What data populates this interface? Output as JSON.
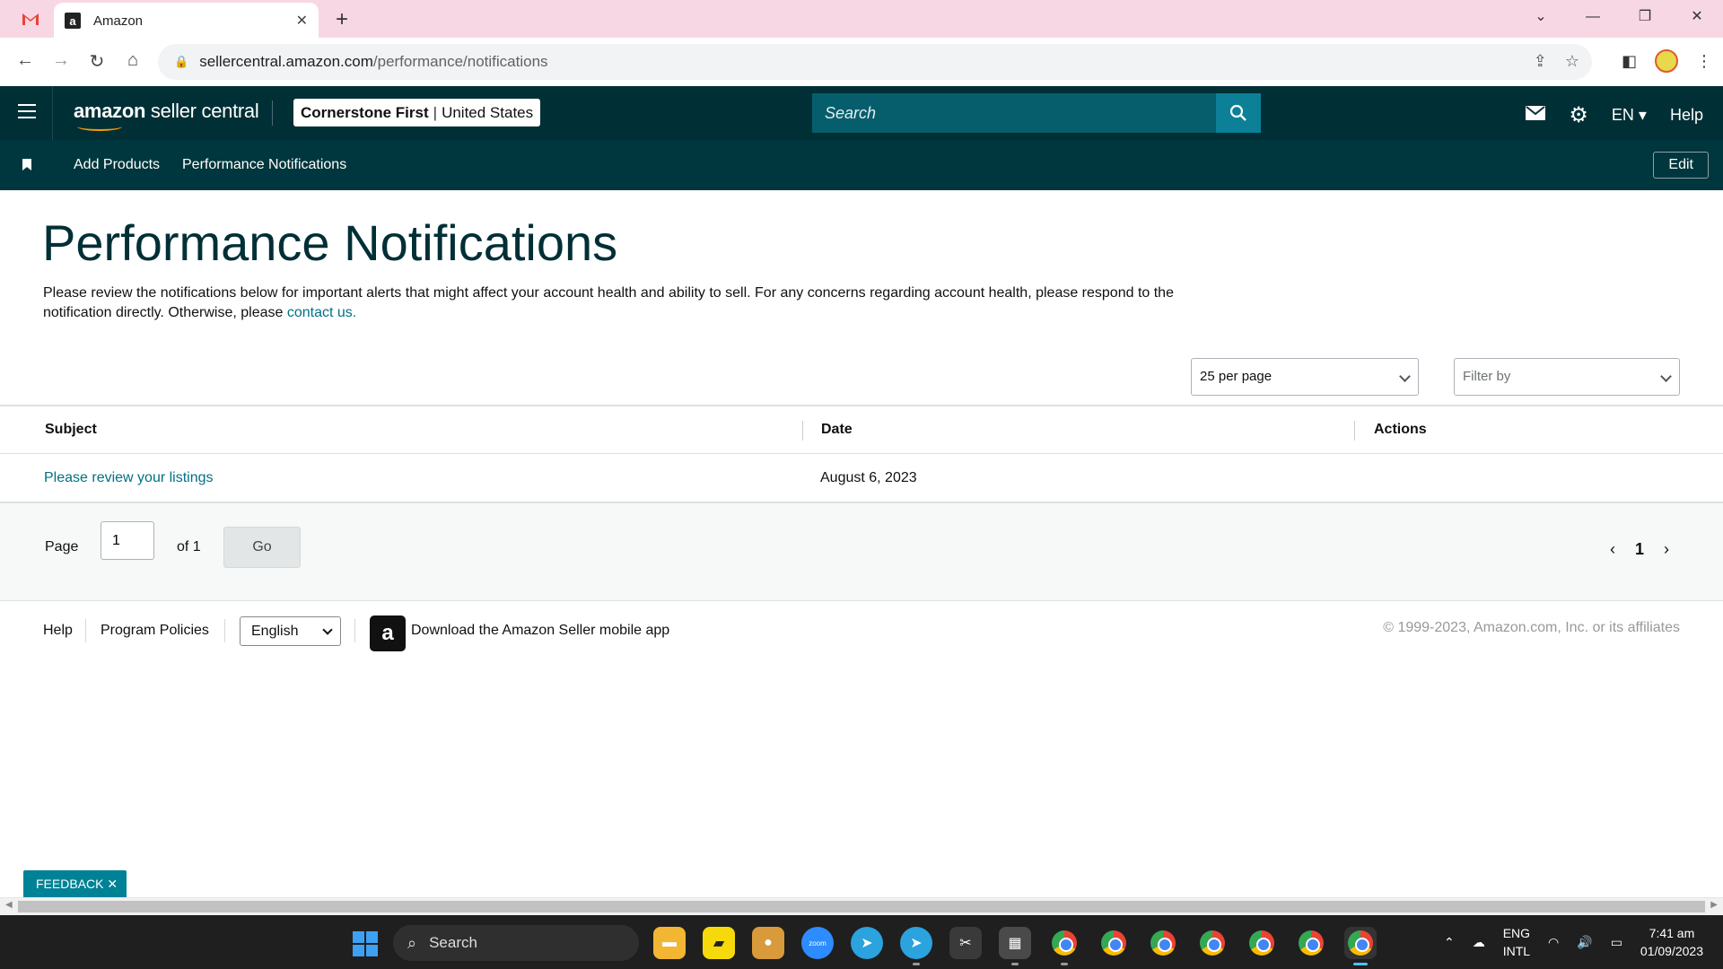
{
  "browser": {
    "tab_title": "Amazon",
    "url_domain": "sellercentral.amazon.com",
    "url_path": "/performance/notifications"
  },
  "header": {
    "logo_amazon": "amazon",
    "logo_product": "seller central",
    "store_name": "Cornerstone First",
    "store_region": "United States",
    "search_placeholder": "Search",
    "language": "EN",
    "help": "Help"
  },
  "nav": {
    "links": [
      "Add Products",
      "Performance Notifications"
    ],
    "edit": "Edit"
  },
  "page": {
    "title": "Performance Notifications",
    "intro": "Please review the notifications below for important alerts that might affect your account health and ability to sell. For any concerns regarding account health, please respond to the notification directly. Otherwise, please",
    "contact_link": "contact us."
  },
  "controls": {
    "per_page": "25 per page",
    "filter_placeholder": "Filter by"
  },
  "table": {
    "columns": [
      "Subject",
      "Date",
      "Actions"
    ],
    "rows": [
      {
        "subject": "Please review your listings",
        "date": "August 6, 2023",
        "actions": ""
      }
    ]
  },
  "pagination": {
    "page_label": "Page",
    "current_input": "1",
    "of_label": "of 1",
    "go": "Go",
    "current_page": "1"
  },
  "footer": {
    "help": "Help",
    "policies": "Program Policies",
    "language": "English",
    "app_text": "Download the Amazon Seller mobile app",
    "copyright": "© 1999-2023, Amazon.com, Inc. or its affiliates"
  },
  "feedback": "FEEDBACK",
  "taskbar": {
    "search": "Search",
    "lang_top": "ENG",
    "lang_bottom": "INTL",
    "time": "7:41 am",
    "date": "01/09/2023"
  }
}
